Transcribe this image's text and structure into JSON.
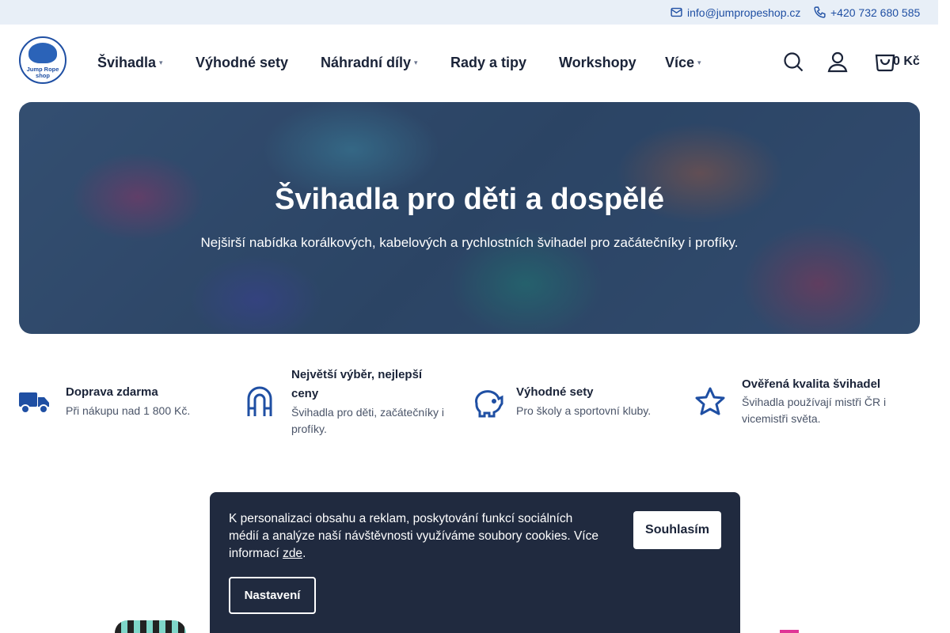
{
  "topbar": {
    "email": "info@jumpropeshop.cz",
    "phone": "+420 732 680 585"
  },
  "logo": {
    "line1": "Jump Rope",
    "line2": "shop"
  },
  "nav": {
    "items": [
      {
        "label": "Švihadla",
        "has_caret": true
      },
      {
        "label": "Výhodné sety",
        "has_caret": false
      },
      {
        "label": "Náhradní díly",
        "has_caret": true
      },
      {
        "label": "Rady a tipy",
        "has_caret": false
      },
      {
        "label": "Workshopy",
        "has_caret": false
      },
      {
        "label": "Více",
        "has_caret": true
      }
    ],
    "caret_glyph": "▾"
  },
  "header_icons": {
    "search": "search-icon",
    "user": "user-icon",
    "cart": "cart-icon"
  },
  "cart": {
    "total": "0 Kč"
  },
  "hero": {
    "title": "Švihadla pro děti a dospělé",
    "subtitle": "Nejširší nabídka korálkových, kabelových a rychlostních švihadel pro začátečníky i profíky."
  },
  "features": [
    {
      "icon": "truck-icon",
      "title": "Doprava zdarma",
      "desc": "Při nákupu nad 1 800 Kč."
    },
    {
      "icon": "magnet-icon",
      "title": "Největší výběr, nejlepší ceny",
      "desc": "Švihadla pro děti, začátečníky i profíky."
    },
    {
      "icon": "piggy-bank-icon",
      "title": "Výhodné sety",
      "desc": "Pro školy a sportovní kluby."
    },
    {
      "icon": "star-icon",
      "title": "Ověřená kvalita švihadel",
      "desc": "Švihadla používají mistři ČR i vicemistři světa."
    }
  ],
  "cookie": {
    "message": "K personalizaci obsahu a reklam, poskytování funkcí sociálních médií a analýze naší návštěvnosti využíváme soubory cookies. Více informací ",
    "link": "zde",
    "after": ".",
    "agree": "Souhlasím",
    "settings": "Nastavení"
  },
  "colors": {
    "brand": "#1f4fa3",
    "topbar_bg": "#e8eff7",
    "cookie_bg": "#202a3f"
  }
}
